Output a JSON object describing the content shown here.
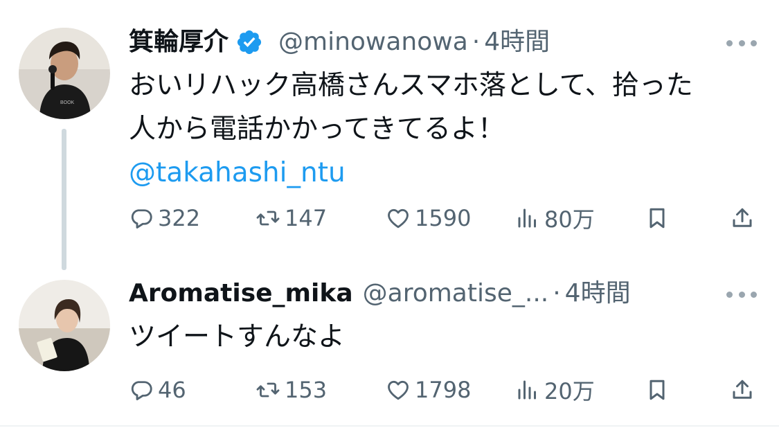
{
  "tweets": [
    {
      "display_name": "箕輪厚介",
      "verified": true,
      "handle": "@minowanowa",
      "separator": "·",
      "time": "4時間",
      "text_lines": [
        "おいリハック高橋さんスマホ落として、拾った",
        "人から電話かかってきてるよ！"
      ],
      "mention": "@takahashi_ntu",
      "stats": {
        "replies": "322",
        "retweets": "147",
        "likes": "1590",
        "views": "80万"
      }
    },
    {
      "display_name": "Aromatise_mika",
      "verified": false,
      "handle": "@aromatise_...",
      "separator": "·",
      "time": "4時間",
      "text_lines": [
        "ツイートすんなよ"
      ],
      "stats": {
        "replies": "46",
        "retweets": "153",
        "likes": "1798",
        "views": "20万"
      }
    }
  ],
  "icons": {
    "verified": "verified-badge-icon",
    "more": "more-dots-icon",
    "reply": "reply-bubble-icon",
    "retweet": "retweet-icon",
    "like": "heart-icon",
    "views": "views-bar-chart-icon",
    "bookmark": "bookmark-icon",
    "share": "share-upload-icon"
  },
  "colors": {
    "text": "#0f1419",
    "secondary": "#536471",
    "link": "#1d9bf0",
    "verified": "#1d9bf0",
    "thread_line": "#cfd9de"
  }
}
